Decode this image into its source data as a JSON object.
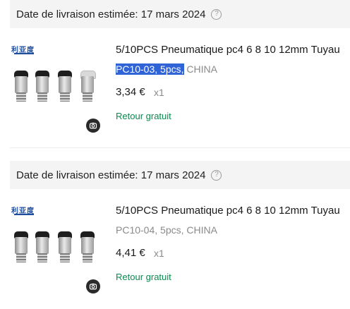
{
  "orders": [
    {
      "delivery_text": "Date de livraison estimée: 17 mars 2024",
      "help_glyph": "?",
      "brand_logo_text": "利亚度",
      "title": "5/10PCS Pneumatique pc4 6 8 10 12mm Tuyau",
      "variant_selected": "PC10-03, 5pcs,",
      "variant_rest": " CHINA",
      "price": "3,34 €",
      "quantity": "x1",
      "return_text": "Retour gratuit"
    },
    {
      "delivery_text": "Date de livraison estimée: 17 mars 2024",
      "help_glyph": "?",
      "brand_logo_text": "利亚度",
      "title": "5/10PCS Pneumatique pc4 6 8 10 12mm Tuyau",
      "variant_selected": "",
      "variant_rest": "PC10-04, 5pcs, CHINA",
      "price": "4,41 €",
      "quantity": "x1",
      "return_text": "Retour gratuit"
    }
  ],
  "colors": {
    "header_bg": "#f4f4f4",
    "selection": "#2f63d6",
    "return_green": "#0a8a4e",
    "brand_blue": "#1f4e9c"
  },
  "icons": [
    "help-circle-icon",
    "camera-icon"
  ]
}
